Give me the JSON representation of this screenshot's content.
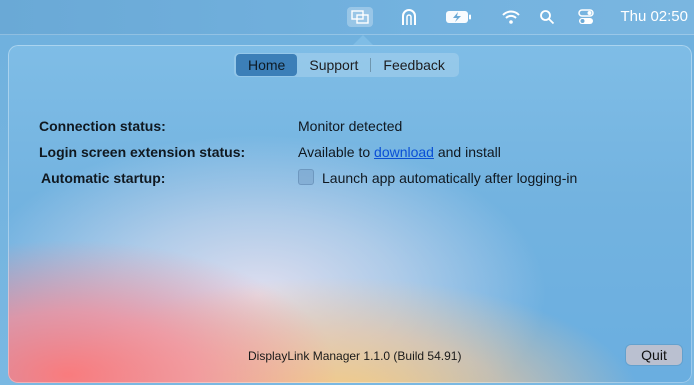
{
  "menubar": {
    "icons": [
      "displaylink-icon",
      "airport-icon",
      "battery-charging-icon",
      "wifi-icon",
      "spotlight-search-icon",
      "control-center-icon"
    ],
    "clock": "Thu 02:50"
  },
  "tabs": [
    {
      "label": "Home",
      "selected": true
    },
    {
      "label": "Support",
      "selected": false
    },
    {
      "label": "Feedback",
      "selected": false
    }
  ],
  "status": {
    "connection_label": "Connection status:",
    "connection_value": "Monitor detected",
    "login_label": "Login screen extension status:",
    "login_value_prefix": "Available to",
    "login_link": "download",
    "login_value_suffix": "and install",
    "startup_label": "Automatic startup:",
    "startup_checkbox_label": "Launch app automatically after logging-in",
    "startup_checked": false
  },
  "footer": {
    "version": "DisplayLink Manager 1.1.0 (Build 54.91)",
    "quit_label": "Quit"
  }
}
